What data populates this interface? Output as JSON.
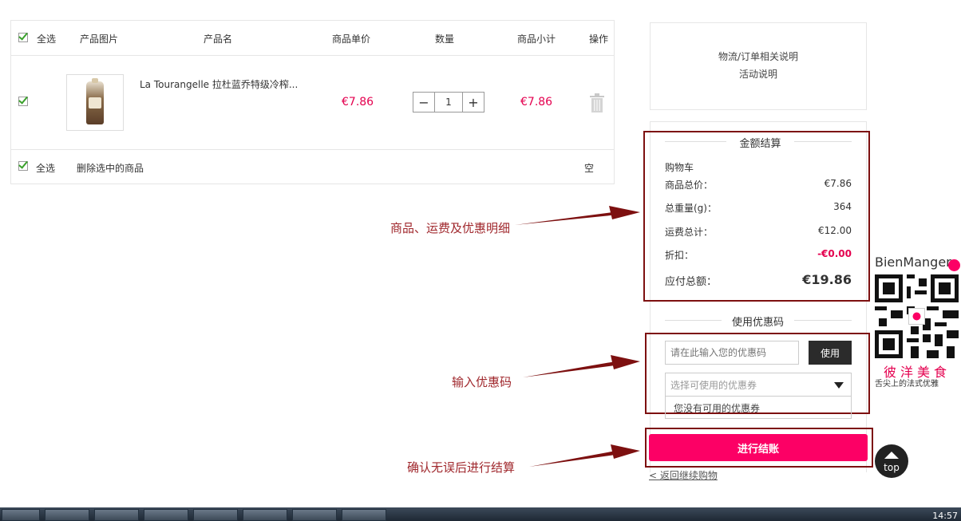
{
  "cart": {
    "headers": {
      "select_all": "全选",
      "image": "产品图片",
      "name": "产品名",
      "unit_price": "商品单价",
      "quantity": "数量",
      "subtotal": "商品小计",
      "action": "操作"
    },
    "items": [
      {
        "name": "La Tourangelle 拉杜蓝乔特级冷榨...",
        "unit_price": "€7.86",
        "quantity": "1",
        "subtotal": "€7.86"
      }
    ],
    "footer": {
      "select_all": "全选",
      "delete_selected": "删除选中的商品",
      "empty": "空"
    }
  },
  "info": {
    "line1": "物流/订单相关说明",
    "line2": "活动说明"
  },
  "summary": {
    "title": "金额结算",
    "cart_label": "购物车",
    "rows": [
      {
        "label": "商品总价：",
        "value": "€7.86"
      },
      {
        "label": "总重量(g)：",
        "value": "364"
      },
      {
        "label": "运费总计：",
        "value": "€12.00"
      },
      {
        "label": "折扣：",
        "value": "-€0.00"
      }
    ],
    "total_label": "应付总额：",
    "total_value": "€19.86"
  },
  "coupon": {
    "title": "使用优惠码",
    "placeholder": "请在此输入您的优惠码",
    "use_button": "使用",
    "select_placeholder": "选择可使用的优惠券",
    "no_coupon": "您没有可用的优惠券"
  },
  "checkout": {
    "button": "进行结账",
    "back_link": "< 返回继续购物"
  },
  "annotations": {
    "summary": "商品、运费及优惠明细",
    "coupon": "输入优惠码",
    "checkout": "确认无误后进行结算"
  },
  "brand": {
    "logo": "BienManger",
    "name_cn": "彼洋美食",
    "slogan": "舌尖上的法式优雅"
  },
  "top_button": "top",
  "taskbar": {
    "time": "14:57"
  },
  "colors": {
    "accent": "#fc0065",
    "price": "#e4004f",
    "annotation": "#a0282d",
    "highlight_box": "#7d1010"
  }
}
